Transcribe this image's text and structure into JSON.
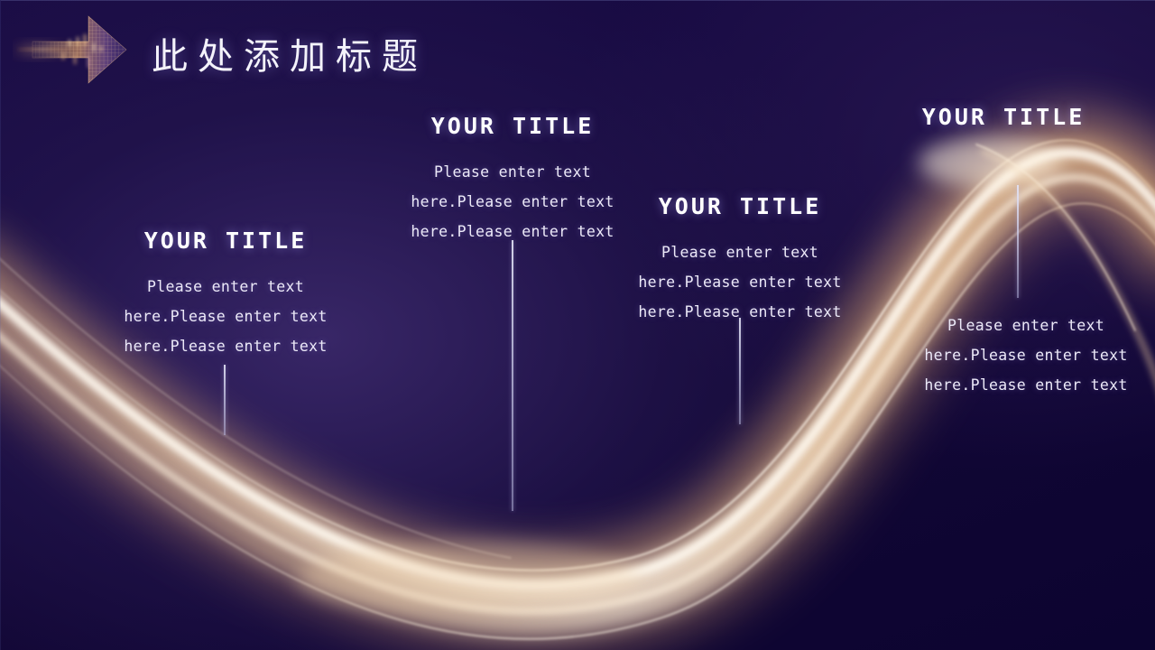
{
  "slide": {
    "title": "此处添加标题",
    "background_color": "#150a3c",
    "accent_color": "#f3cfa0",
    "text_color": "#ffffff"
  },
  "header": {
    "decoration_icon": "pixel-arrow-right-icon"
  },
  "callouts": [
    {
      "id": "callout-1",
      "title": "YOUR TITLE",
      "body_lines": [
        "Please enter text",
        "here.Please enter text",
        "here.Please enter text"
      ]
    },
    {
      "id": "callout-2",
      "title": "YOUR TITLE",
      "body_lines": [
        "Please enter text",
        "here.Please enter text",
        "here.Please enter text"
      ]
    },
    {
      "id": "callout-3",
      "title": "YOUR TITLE",
      "body_lines": [
        "Please enter text",
        "here.Please enter text",
        "here.Please enter text"
      ]
    },
    {
      "id": "callout-4",
      "title": "YOUR TITLE",
      "body_lines": [
        "Please enter text",
        "here.Please enter text",
        "here.Please enter text"
      ]
    }
  ]
}
